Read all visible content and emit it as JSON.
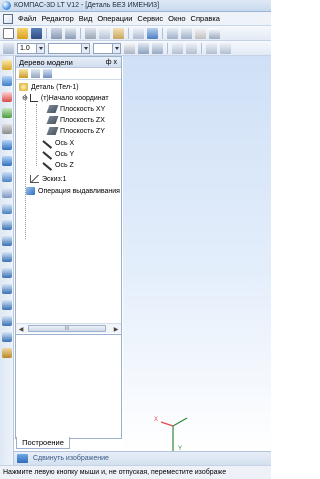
{
  "window": {
    "title": "КОМПАС-3D LT V12 - [Деталь БЕЗ ИМЕНИ3]"
  },
  "menu": [
    "Файл",
    "Редактор",
    "Вид",
    "Операции",
    "Сервис",
    "Окно",
    "Справка"
  ],
  "toolbar2": {
    "scale_value": "1.0"
  },
  "model_tree": {
    "title": "Дерево модели",
    "pin_glyph": "ф x",
    "root": "Деталь (Тел-1)",
    "origin": "(т)Начало координат",
    "planes": [
      "Плоскость XY",
      "Плоскость ZX",
      "Плоскость ZY"
    ],
    "axes": [
      "Ось X",
      "Ось Y",
      "Ось Z"
    ],
    "sketch": "Эскиз:1",
    "operation": "Операция выдавливания"
  },
  "scrollbar": {
    "thumb_label": "III"
  },
  "tabs": {
    "build": "Построение"
  },
  "hint_panel": {
    "label": "Сдвинуть изображение"
  },
  "status": {
    "text": "Нажмите левую кнопку мыши и, не отпуская, переместите изображе"
  },
  "colors": {
    "accent": "#2d6bb5",
    "canvas_top": "#cfe0f6",
    "axis_x": "#e0474c",
    "axis_y": "#2e8b3e"
  }
}
